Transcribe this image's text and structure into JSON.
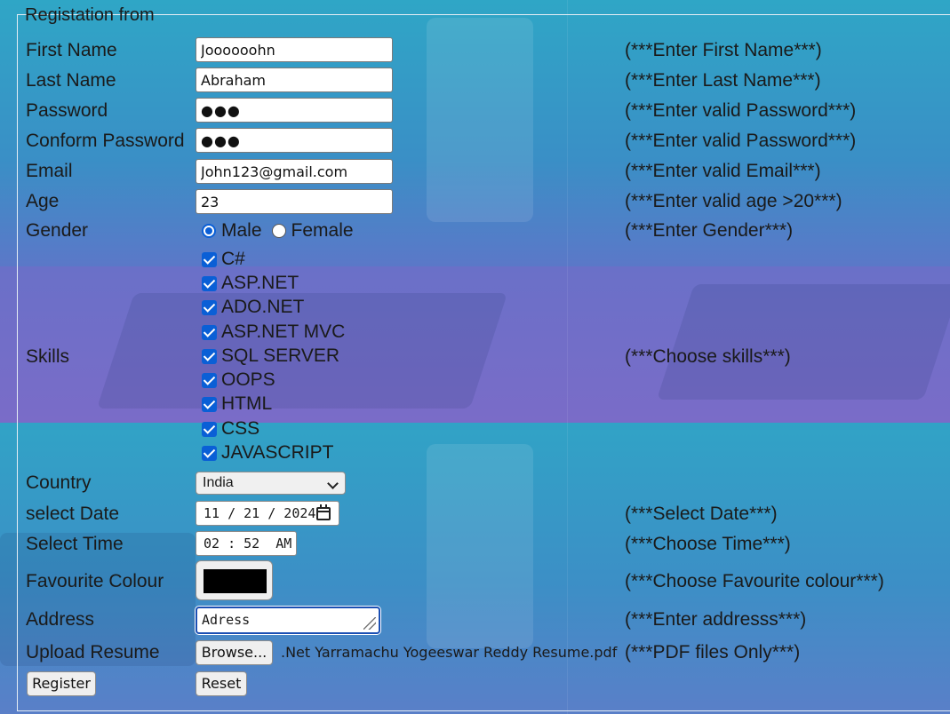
{
  "form": {
    "legend": "Registation from",
    "first_name": {
      "label": "First Name",
      "value": "Joooooohn",
      "hint": "(***Enter First Name***)"
    },
    "last_name": {
      "label": "Last Name",
      "value": "Abraham",
      "hint": "(***Enter Last Name***)"
    },
    "password": {
      "label": "Password",
      "value": "●●●",
      "hint": "(***Enter valid Password***)"
    },
    "confirm_password": {
      "label": "Conform Password",
      "value": "●●●",
      "hint": "(***Enter valid Password***)"
    },
    "email": {
      "label": "Email",
      "value": "John123@gmail.com",
      "hint": "(***Enter valid Email***)"
    },
    "age": {
      "label": "Age",
      "value": "23",
      "hint": "(***Enter valid age >20***)"
    },
    "gender": {
      "label": "Gender",
      "options": [
        "Male",
        "Female"
      ],
      "selected": "Male",
      "hint": "(***Enter Gender***)"
    },
    "skills": {
      "label": "Skills",
      "items": [
        "C#",
        "ASP.NET",
        "ADO.NET",
        "ASP.NET MVC",
        "SQL SERVER",
        "OOPS",
        "HTML",
        "CSS",
        "JAVASCRIPT"
      ],
      "checked": [
        true,
        true,
        true,
        true,
        true,
        true,
        true,
        true,
        true
      ],
      "hint": "(***Choose skills***)"
    },
    "country": {
      "label": "Country",
      "selected": "India",
      "icon": "chevron-down-icon"
    },
    "date": {
      "label": "select Date",
      "value": "11 / 21 / 2024",
      "icon": "calendar-icon",
      "hint": "(***Select Date***)"
    },
    "time": {
      "label": "Select Time",
      "value": "02 : 52  AM",
      "hint": "(***Choose Time***)"
    },
    "colour": {
      "label": "Favourite Colour",
      "value": "#000000",
      "hint": "(***Choose Favourite colour***)"
    },
    "address": {
      "label": "Address",
      "value": "Adress",
      "hint": "(***Enter addresss***)"
    },
    "resume": {
      "label": "Upload Resume",
      "button": "Browse...",
      "filename": ".Net Yarramachu Yogeeswar Reddy Resume.pdf",
      "hint": "(***PDF files Only***)"
    },
    "buttons": {
      "register": "Register",
      "reset": "Reset"
    }
  },
  "colors": {
    "accent": "#0a5fd6",
    "background_top": "#2fa6c6",
    "background_mid": "#6e6fc8"
  }
}
